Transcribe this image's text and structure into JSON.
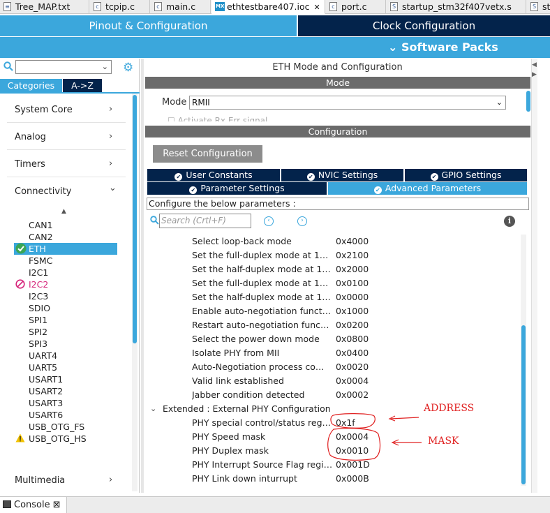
{
  "editor_tabs": [
    {
      "label": "Tree_MAP.txt",
      "icon": "text-file-icon",
      "active": false
    },
    {
      "label": "tcpip.c",
      "icon": "c-file-icon",
      "active": false
    },
    {
      "label": "main.c",
      "icon": "c-file-icon",
      "active": false
    },
    {
      "label": "ethtestbare407.ioc",
      "icon": "mx-file-icon",
      "active": true
    },
    {
      "label": "port.c",
      "icon": "c-file-icon",
      "active": false
    },
    {
      "label": "startup_stm32f407vetx.s",
      "icon": "asm-file-icon",
      "active": false
    },
    {
      "label": "st",
      "icon": "asm-file-icon",
      "active": false
    }
  ],
  "header": {
    "pinout": "Pinout & Configuration",
    "clock": "Clock Configuration",
    "software_packs": "Software Packs",
    "software_packs_chevron": "⌄"
  },
  "left": {
    "categories_tab": "Categories",
    "az_tab": "A->Z",
    "categories": [
      {
        "label": "System Core",
        "chevron": "›"
      },
      {
        "label": "Analog",
        "chevron": "›"
      },
      {
        "label": "Timers",
        "chevron": "›"
      },
      {
        "label": "Connectivity",
        "chevron": "⌄"
      },
      {
        "label": "Multimedia",
        "chevron": "›"
      }
    ],
    "peripherals": [
      {
        "label": "CAN1",
        "status": "none"
      },
      {
        "label": "CAN2",
        "status": "none"
      },
      {
        "label": "ETH",
        "status": "ok"
      },
      {
        "label": "FSMC",
        "status": "none"
      },
      {
        "label": "I2C1",
        "status": "none"
      },
      {
        "label": "I2C2",
        "status": "disabled"
      },
      {
        "label": "I2C3",
        "status": "none"
      },
      {
        "label": "SDIO",
        "status": "none"
      },
      {
        "label": "SPI1",
        "status": "none"
      },
      {
        "label": "SPI2",
        "status": "none"
      },
      {
        "label": "SPI3",
        "status": "none"
      },
      {
        "label": "UART4",
        "status": "none"
      },
      {
        "label": "UART5",
        "status": "none"
      },
      {
        "label": "USART1",
        "status": "none"
      },
      {
        "label": "USART2",
        "status": "none"
      },
      {
        "label": "USART3",
        "status": "none"
      },
      {
        "label": "USART6",
        "status": "none"
      },
      {
        "label": "USB_OTG_FS",
        "status": "none"
      },
      {
        "label": "USB_OTG_HS",
        "status": "warning"
      }
    ]
  },
  "right": {
    "title": "ETH Mode and Configuration",
    "mode_header": "Mode",
    "mode_label": "Mode",
    "mode_value": "RMII",
    "activate_label": "Activate Rx Err signal",
    "config_header": "Configuration",
    "reset_button": "Reset Configuration",
    "tabs_row1": [
      "User Constants",
      "NVIC Settings",
      "GPIO Settings"
    ],
    "tabs_row2": [
      "Parameter Settings",
      "Advanced Parameters"
    ],
    "active_tab": "Advanced Parameters",
    "configure_text": "Configure the below parameters :",
    "search_placeholder": "Search (Crtl+F)",
    "params": [
      {
        "name": "Select loop-back mode",
        "value": "0x4000"
      },
      {
        "name": "Set the full-duplex mode at 1…",
        "value": "0x2100"
      },
      {
        "name": "Set the half-duplex mode at 1…",
        "value": "0x2000"
      },
      {
        "name": "Set the full-duplex mode at 1…",
        "value": "0x0100"
      },
      {
        "name": "Set the half-duplex mode at 1…",
        "value": "0x0000"
      },
      {
        "name": "Enable auto-negotiation funct…",
        "value": "0x1000"
      },
      {
        "name": "Restart auto-negotiation func…",
        "value": "0x0200"
      },
      {
        "name": "Select the power down mode",
        "value": "0x0800"
      },
      {
        "name": "Isolate PHY from MII",
        "value": "0x0400"
      },
      {
        "name": "Auto-Negotiation process co…",
        "value": "0x0020"
      },
      {
        "name": "Valid link established",
        "value": "0x0004"
      },
      {
        "name": "Jabber condition detected",
        "value": "0x0002"
      }
    ],
    "extended_group": "Extended : External PHY Configuration",
    "extended_params": [
      {
        "name": "PHY special control/status reg…",
        "value": "0x1f"
      },
      {
        "name": "PHY Speed mask",
        "value": "0x0004"
      },
      {
        "name": "PHY Duplex mask",
        "value": "0x0010"
      },
      {
        "name": "PHY Interrupt Source Flag regi…",
        "value": "0x001D"
      },
      {
        "name": "PHY Link down inturrupt",
        "value": "0x000B"
      }
    ]
  },
  "annotations": {
    "address": "ADDRESS",
    "mask": "MASK",
    "color": "#e02020"
  },
  "console": {
    "label": "Console",
    "close": "⊠"
  },
  "colors": {
    "accent": "#3ba7dc",
    "dark": "#03234b",
    "section_header": "#6b6b6b",
    "ok_green": "#3aa655",
    "warning": "#f2c200",
    "disabled": "#d6247a"
  }
}
